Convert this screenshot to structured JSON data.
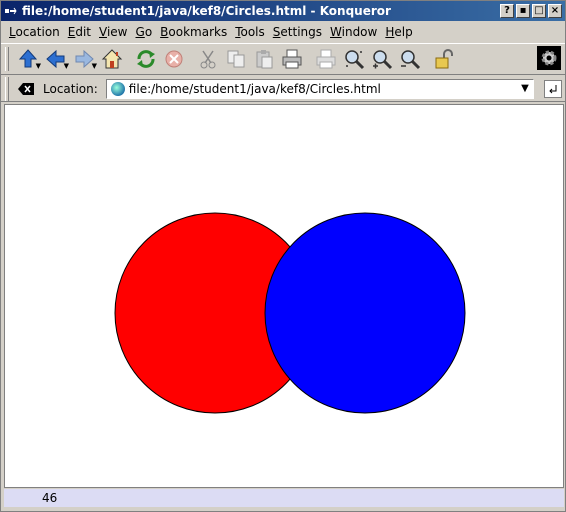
{
  "window": {
    "title": "file:/home/student1/java/kef8/Circles.html - Konqueror",
    "buttons": [
      "?",
      "▪",
      "□",
      "×"
    ]
  },
  "menubar": {
    "items": [
      "Location",
      "Edit",
      "View",
      "Go",
      "Bookmarks",
      "Tools",
      "Settings",
      "Window",
      "Help"
    ]
  },
  "toolbar": {
    "icons": [
      "up-arrow-icon",
      "back-arrow-icon",
      "forward-arrow-icon",
      "home-icon",
      "reload-icon",
      "stop-icon",
      "cut-icon",
      "copy-icon",
      "paste-icon",
      "print-icon",
      "print-frame-icon",
      "zoom-fit-icon",
      "zoom-in-icon",
      "zoom-out-icon",
      "lock-icon",
      "gear-icon"
    ]
  },
  "location": {
    "label": "Location:",
    "url": "file:/home/student1/java/kef8/Circles.html"
  },
  "content": {
    "circles": [
      {
        "name": "red-circle",
        "color": "#ff0000"
      },
      {
        "name": "blue-circle",
        "color": "#0000ff"
      }
    ]
  },
  "status": {
    "text": "46"
  }
}
